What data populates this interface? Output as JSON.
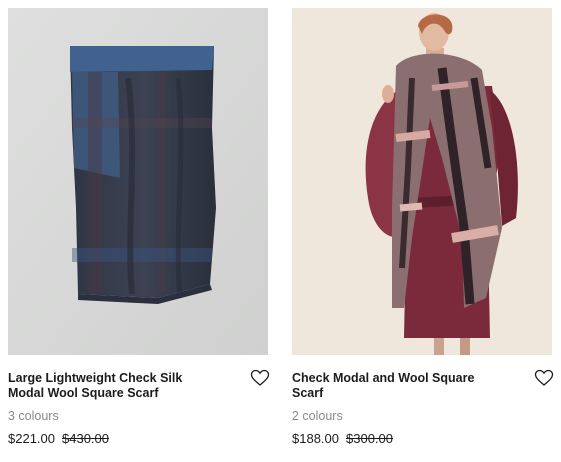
{
  "products": [
    {
      "title": "Large Lightweight Check Silk Modal Wool Square Scarf",
      "colours": "3 colours",
      "price": "$221.00",
      "was_price": "$430.00"
    },
    {
      "title": "Check Modal and Wool Square Scarf",
      "colours": "2 colours",
      "price": "$188.00",
      "was_price": "$300.00"
    }
  ],
  "icons": {
    "wishlist": "heart-outline-icon"
  },
  "colors": {
    "image_bg_left": "#d8d9d8",
    "image_bg_right": "#efe5da",
    "muted_text": "#8a8a8a"
  }
}
